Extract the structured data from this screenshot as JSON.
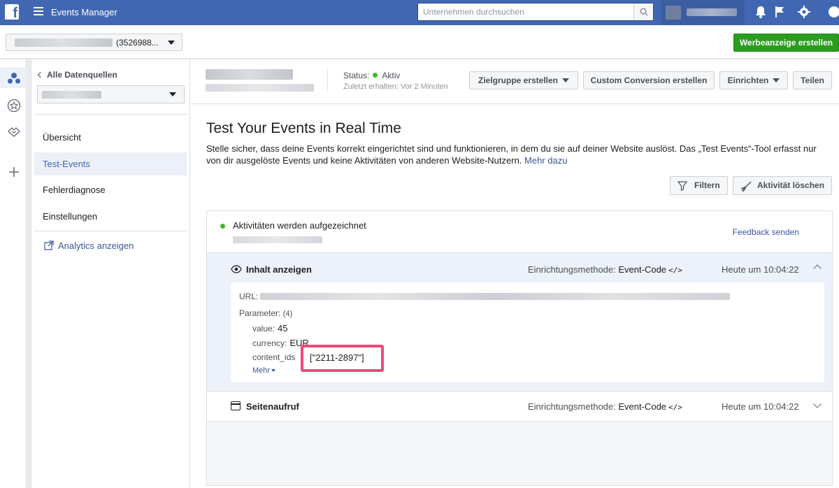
{
  "app": {
    "title": "Events Manager",
    "logo": "f"
  },
  "search": {
    "placeholder": "Unternehmen durchsuchen"
  },
  "account": {
    "id_suffix": "(3526988..."
  },
  "toolbar": {
    "create_ad_label": "Werbeanzeige erstellen"
  },
  "sidebar": {
    "back_label": "Alle Datenquellen",
    "items": [
      {
        "label": "Übersicht",
        "active": false
      },
      {
        "label": "Test-Events",
        "active": true
      },
      {
        "label": "Fehlerdiagnose",
        "active": false
      },
      {
        "label": "Einstellungen",
        "active": false
      }
    ],
    "analytics_label": "Analytics anzeigen"
  },
  "header": {
    "status_label": "Status:",
    "status_value": "Aktiv",
    "last_received": "Zuletzt erhalten: Vor 2 Minuten",
    "buttons": {
      "audience": "Zielgruppe erstellen",
      "custom_conversion": "Custom Conversion erstellen",
      "setup": "Einrichten",
      "share": "Teilen"
    }
  },
  "main": {
    "title": "Test Your Events in Real Time",
    "description": "Stelle sicher, dass deine Events korrekt eingerichtet sind und funktionieren, in dem du sie auf deiner Website auslöst. Das „Test Events“-Tool erfasst nur von dir ausgelöste Events und keine Aktivitäten von anderen Website-Nutzern.",
    "more_link": "Mehr dazu",
    "filter_label": "Filtern",
    "clear_label": "Aktivität löschen"
  },
  "events": {
    "recording_text": "Aktivitäten werden aufgezeichnet",
    "feedback_label": "Feedback senden",
    "list": [
      {
        "title": "Inhalt anzeigen",
        "method_label": "Einrichtungsmethode:",
        "method_value": "Event-Code",
        "time": "Heute um 10:04:22",
        "expanded": true,
        "url_label": "URL:",
        "params_label": "Parameter:",
        "params_count": "(4)",
        "params": [
          {
            "key": "value:",
            "value": "45"
          },
          {
            "key": "currency:",
            "value": "EUR"
          },
          {
            "key": "content_ids",
            "value": "[\"2211-2897\"]"
          }
        ],
        "more_label": "Mehr"
      },
      {
        "title": "Seitenaufruf",
        "method_label": "Einrichtungsmethode:",
        "method_value": "Event-Code",
        "time": "Heute um 10:04:22",
        "expanded": false
      }
    ]
  },
  "colors": {
    "brand": "#4267b2",
    "accent_green": "#2a9d1f",
    "status_green": "#42b72a",
    "highlight": "#ee4a7b",
    "link": "#385898"
  }
}
